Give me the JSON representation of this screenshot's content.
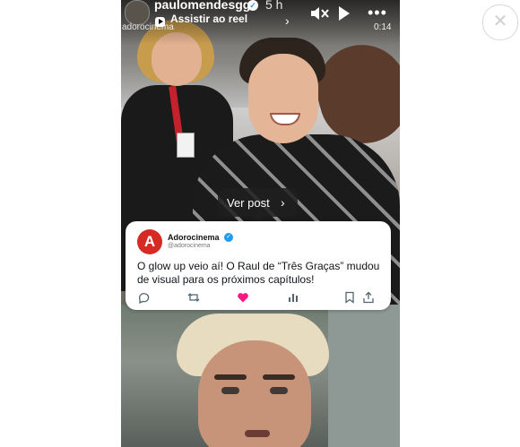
{
  "header": {
    "username": "paulomendesgg",
    "time": "5 h",
    "reel_link": "Assistir ao reel",
    "credit": "adorocinema",
    "duration": "0:14"
  },
  "controls": {
    "mute_icon": "speaker-muted-icon",
    "play_icon": "play-icon",
    "more_icon": "more-horizontal-icon",
    "close_icon": "close-icon"
  },
  "overlay": {
    "ver_post": "Ver post"
  },
  "post": {
    "logo_letter": "A",
    "account_name": "Adorocinema",
    "handle": "@adorocinema",
    "text": "O glow up veio aí! O Raul de “Três Graças” mudou de visual para os próximos capítulos!",
    "action_icons": [
      "reply-icon",
      "retweet-icon",
      "like-icon",
      "views-icon",
      "bookmark-icon",
      "share-icon"
    ],
    "brand_color": "#d62a25",
    "like_color": "#f91880"
  }
}
